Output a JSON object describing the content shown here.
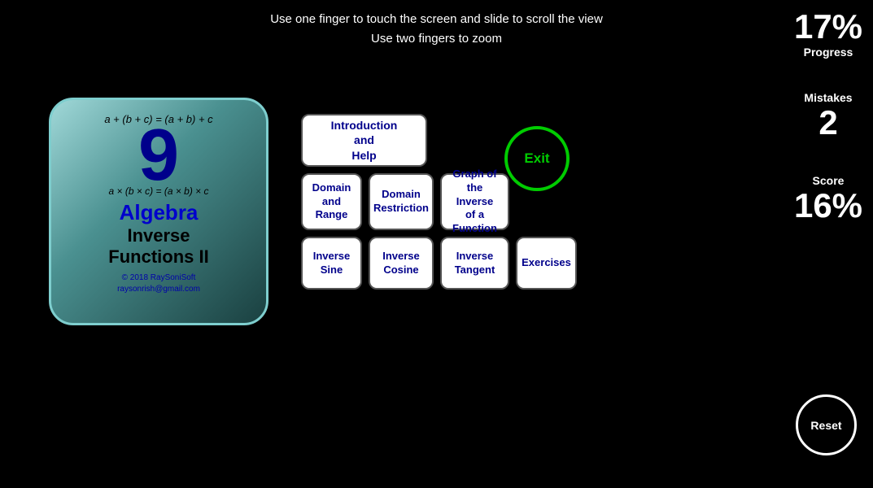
{
  "instructions": {
    "line1": "Use one finger to touch the screen and slide to scroll the view",
    "line2": "Use two fingers to zoom"
  },
  "stats": {
    "progress_value": "17%",
    "progress_label": "Progress",
    "mistakes_label": "Mistakes",
    "mistakes_value": "2",
    "score_label": "Score",
    "score_value": "16%"
  },
  "reset_button": "Reset",
  "exit_button": "Exit",
  "app_icon": {
    "math_line1": "a + (b + c) = (a + b) + c",
    "number": "9",
    "math_line2": "a × (b × c) = (a × b) × c",
    "title_color": "Algebra",
    "title_main1": "Inverse",
    "title_main2": "Functions II",
    "copyright": "© 2018 RaySoniSoft\nraysonrish@gmail.com"
  },
  "menu": {
    "intro_label": "Introduction\nand\nHelp",
    "domain_range_label": "Domain\nand\nRange",
    "domain_restrict_label": "Domain\nRestriction",
    "graph_inverse_label": "Graph of\nthe Inverse\nof a\nFunction",
    "inv_sine_label": "Inverse\nSine",
    "inv_cosine_label": "Inverse\nCosine",
    "inv_tangent_label": "Inverse\nTangent",
    "exercises_label": "Exercises"
  }
}
